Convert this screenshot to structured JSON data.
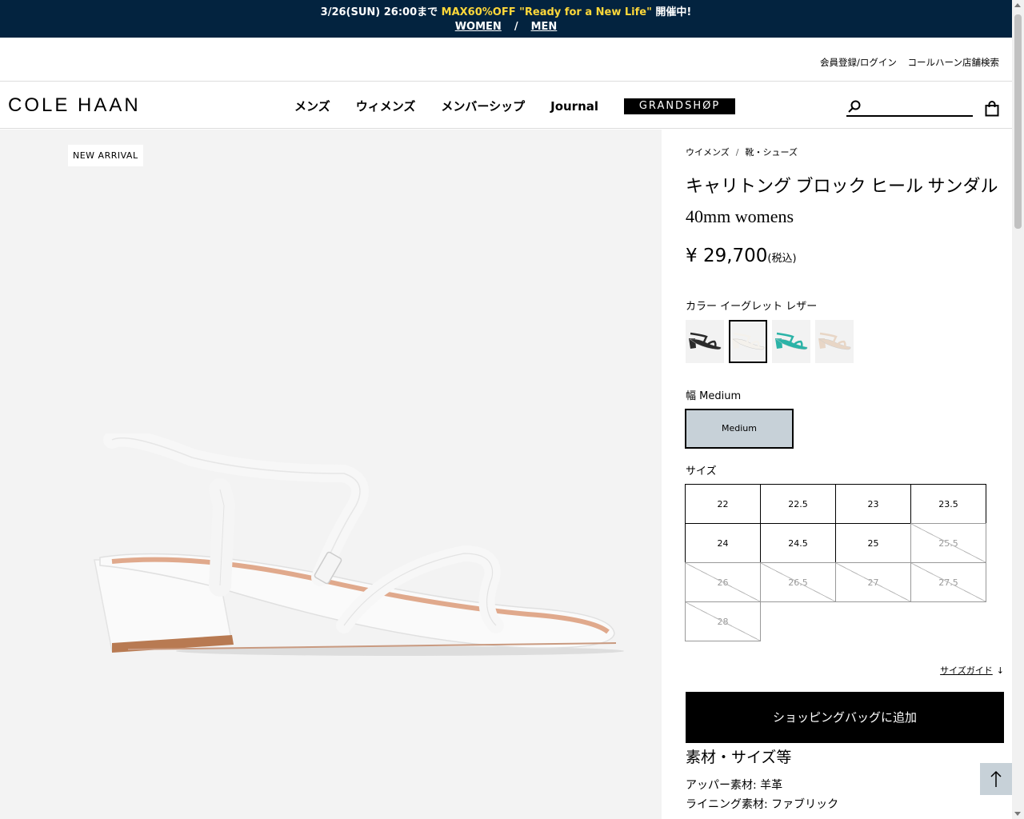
{
  "promo": {
    "prefix": "3/26(SUN) 26:00まで ",
    "highlight": "MAX60%OFF \"Ready for a New Life\"",
    "suffix": " 開催中!",
    "women_link": "WOMEN",
    "separator": "/",
    "men_link": "MEN",
    "bg_color": "#03233f",
    "highlight_color": "#ffd83a"
  },
  "utility": {
    "login": "会員登録/ログイン",
    "store_search": "コールハーン店舗検索"
  },
  "header": {
    "logo": "COLE HAAN",
    "nav": [
      "メンズ",
      "ウィメンズ",
      "メンバーシップ",
      "Journal"
    ],
    "grandshop": "GRANDSHØP",
    "search_placeholder": ""
  },
  "gallery": {
    "badge": "NEW ARRIVAL"
  },
  "product": {
    "breadcrumbs": [
      "ウイメンズ",
      "靴・シューズ"
    ],
    "breadcrumb_sep": "/",
    "title_line1": "キャリトング ブロック ヒール サンダル",
    "title_line2": "40mm womens",
    "price": "¥ 29,700",
    "price_tax": "(税込)",
    "color_label": "カラー イーグレット レザー",
    "swatches": [
      {
        "name": "black",
        "color": "#2a2a2a",
        "selected": false
      },
      {
        "name": "egret",
        "color": "#f4f1ec",
        "selected": true
      },
      {
        "name": "teal",
        "color": "#2bb3a7",
        "selected": false
      },
      {
        "name": "nude",
        "color": "#e8d6c6",
        "selected": false
      }
    ],
    "width_label": "幅 Medium",
    "width_option": "Medium",
    "size_label": "サイズ",
    "sizes": [
      {
        "label": "22",
        "available": true
      },
      {
        "label": "22.5",
        "available": true
      },
      {
        "label": "23",
        "available": true
      },
      {
        "label": "23.5",
        "available": true
      },
      {
        "label": "24",
        "available": true
      },
      {
        "label": "24.5",
        "available": true
      },
      {
        "label": "25",
        "available": true
      },
      {
        "label": "25.5",
        "available": false
      },
      {
        "label": "26",
        "available": false
      },
      {
        "label": "26.5",
        "available": false
      },
      {
        "label": "27",
        "available": false
      },
      {
        "label": "27.5",
        "available": false
      },
      {
        "label": "28",
        "available": false
      }
    ],
    "size_guide": "サイズガイド",
    "size_guide_arrow": "↓",
    "add_to_bag": "ショッピングバッグに追加",
    "materials_title": "素材・サイズ等",
    "materials": [
      "アッパー素材: 羊革",
      "ライニング素材: ファブリック"
    ]
  }
}
